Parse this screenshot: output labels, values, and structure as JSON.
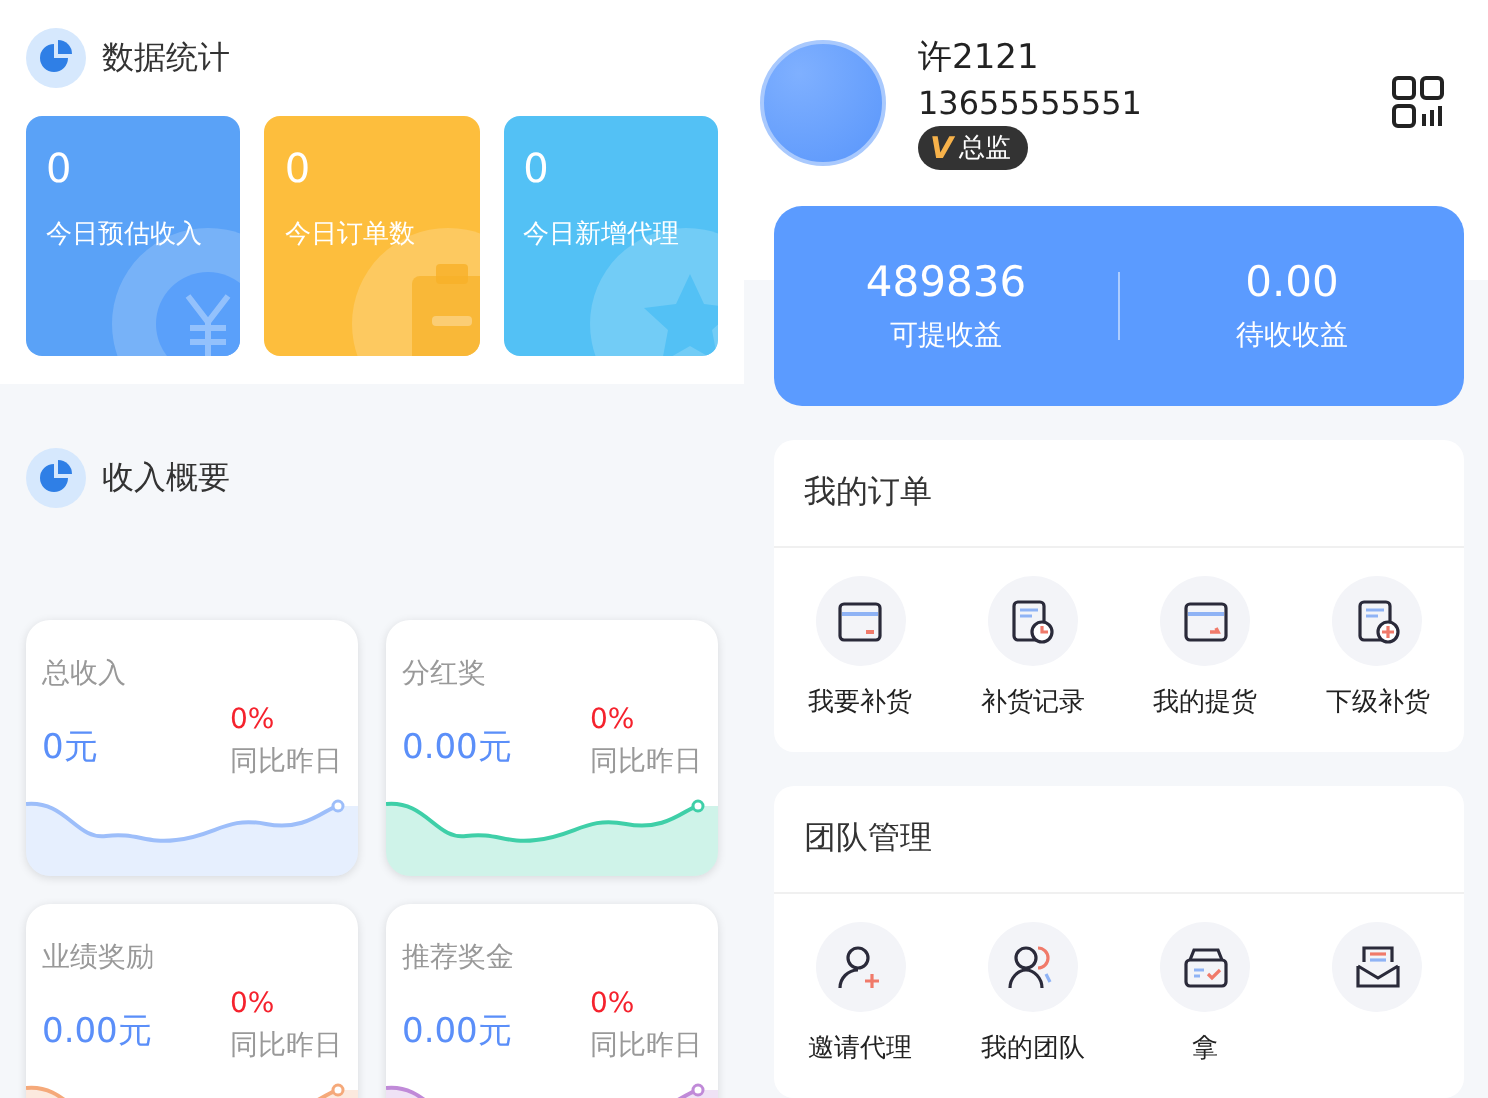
{
  "stats": {
    "title": "数据统计",
    "cards": [
      {
        "value": "0",
        "label": "今日预估收入",
        "kind": "yuan",
        "color": "#5aa2f7"
      },
      {
        "value": "0",
        "label": "今日订单数",
        "kind": "clipboard",
        "color": "#fdbe3d"
      },
      {
        "value": "0",
        "label": "今日新增代理",
        "kind": "star",
        "color": "#53c1f5"
      }
    ]
  },
  "income": {
    "title": "收入概要",
    "cards": [
      {
        "title": "总收入",
        "amount": "0元",
        "change": "0%",
        "compare": "同比昨日",
        "color": "#9dbefa"
      },
      {
        "title": "分红奖",
        "amount": "0.00元",
        "change": "0%",
        "compare": "同比昨日",
        "color": "#3fcfa8"
      },
      {
        "title": "业绩奖励",
        "amount": "0.00元",
        "change": "0%",
        "compare": "同比昨日",
        "color": "#f5a97a"
      },
      {
        "title": "推荐奖金",
        "amount": "0.00元",
        "change": "0%",
        "compare": "同比昨日",
        "color": "#c08ad8"
      }
    ]
  },
  "profile": {
    "name": "许2121",
    "phone": "13655555551",
    "badge": {
      "icon": "V",
      "label": "总监"
    }
  },
  "balance": [
    {
      "value": "489836",
      "label": "可提收益"
    },
    {
      "value": "0.00",
      "label": "待收收益"
    }
  ],
  "orders": {
    "title": "我的订单",
    "items": [
      {
        "label": "我要补货",
        "kind": "card-minus"
      },
      {
        "label": "补货记录",
        "kind": "doc-clock"
      },
      {
        "label": "我的提货",
        "kind": "card-arrow"
      },
      {
        "label": "下级补货",
        "kind": "doc-plus"
      }
    ]
  },
  "team": {
    "title": "团队管理",
    "items": [
      {
        "label": "邀请代理",
        "kind": "user-plus"
      },
      {
        "label": "我的团队",
        "kind": "users"
      },
      {
        "label": "拿",
        "kind": "box-check"
      },
      {
        "kind": "mail"
      }
    ]
  }
}
